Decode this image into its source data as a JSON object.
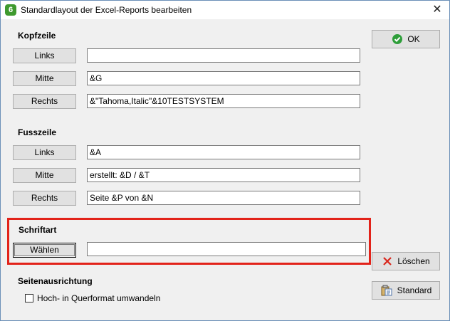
{
  "window": {
    "title": "Standardlayout der Excel-Reports bearbeiten",
    "app_icon_glyph": "6",
    "close_glyph": "✕"
  },
  "kopfzeile": {
    "label": "Kopfzeile",
    "links_label": "Links",
    "links_value": "",
    "mitte_label": "Mitte",
    "mitte_value": "&G",
    "rechts_label": "Rechts",
    "rechts_value": "&\"Tahoma,Italic\"&10TESTSYSTEM"
  },
  "fusszeile": {
    "label": "Fusszeile",
    "links_label": "Links",
    "links_value": "&A",
    "mitte_label": "Mitte",
    "mitte_value": "erstellt: &D / &T",
    "rechts_label": "Rechts",
    "rechts_value": "Seite &P von &N"
  },
  "schriftart": {
    "label": "Schriftart",
    "waehlen_label": "Wählen",
    "value": ""
  },
  "seitenausrichtung": {
    "label": "Seitenausrichtung",
    "checkbox_label": "Hoch- in Querformat umwandeln",
    "checked": false
  },
  "side_buttons": {
    "ok_label": "OK",
    "loeschen_label": "Löschen",
    "standard_label": "Standard"
  },
  "colors": {
    "highlight": "#e2231a",
    "ok_check": "#2e9e3a",
    "delete_x": "#d9261c",
    "title_icon": "#3f9a2e"
  }
}
